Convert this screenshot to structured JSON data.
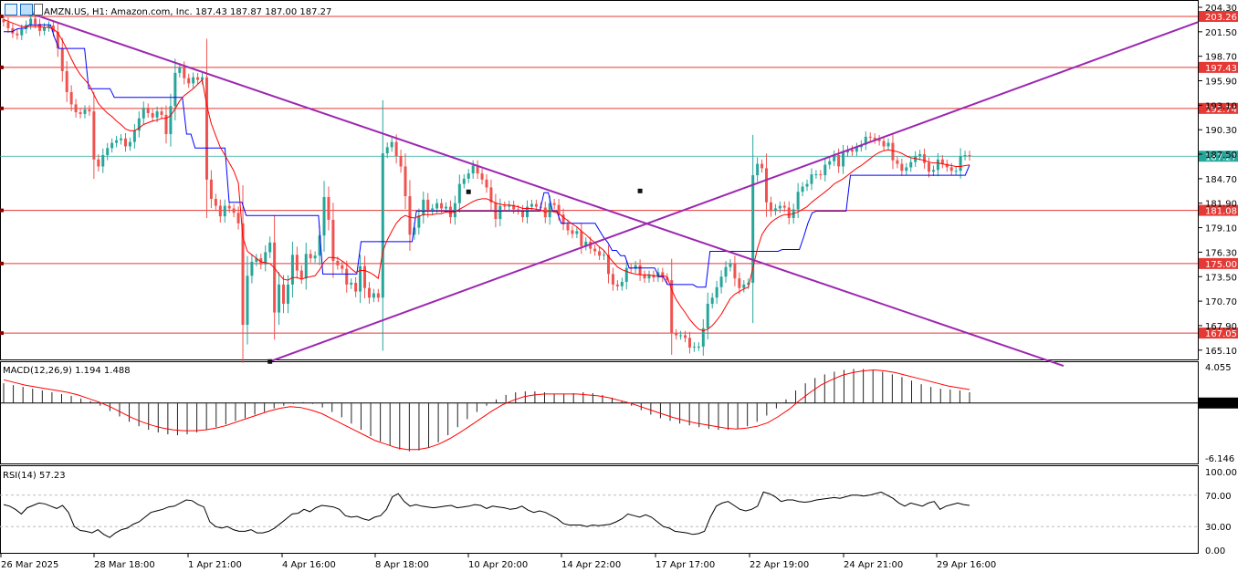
{
  "header": {
    "symbol_line": "AMZN.US, H1:  Amazon.com, Inc.  187.43 187.87 187.00 187.27",
    "icons": [
      "chart-grid-icon",
      "chart-window-icon",
      "chart-candle-icon"
    ]
  },
  "colors": {
    "bull": "#26a69a",
    "bear": "#ef5350",
    "tenkan": "#ff0000",
    "kijun": "#0000ff",
    "trendline": "#9c27b0",
    "level": "#e53935",
    "last_price": "#26a69a"
  },
  "chart_data": [
    {
      "type": "candlestick",
      "title": "AMZN.US, H1:  Amazon.com, Inc.",
      "ohlc_last": {
        "open": 187.43,
        "high": 187.87,
        "low": 187.0,
        "close": 187.27
      },
      "y_range": [
        163.2,
        204.3
      ],
      "y_ticks": [
        "204.30",
        "201.50",
        "198.70",
        "195.90",
        "193.10",
        "190.30",
        "187.50",
        "184.70",
        "181.90",
        "179.10",
        "176.30",
        "173.50",
        "170.70",
        "167.90",
        "165.10"
      ],
      "x_ticks": [
        "26 Mar 2025",
        "28 Mar 18:00",
        "1 Apr 21:00",
        "4 Apr 16:00",
        "8 Apr 18:00",
        "10 Apr 20:00",
        "14 Apr 22:00",
        "17 Apr 17:00",
        "22 Apr 19:00",
        "24 Apr 21:00",
        "29 Apr 16:00"
      ],
      "levels": [
        203.26,
        197.43,
        192.74,
        181.08,
        175.0,
        167.05
      ],
      "level_labels": [
        "203.26",
        "197.43",
        "192.74",
        "181.08",
        "175.00",
        "167.05"
      ],
      "last_price": 187.27,
      "last_price_label": "187.27",
      "closes": [
        202.6,
        201.9,
        201.3,
        201.1,
        201.8,
        202.3,
        203.0,
        202.4,
        201.6,
        202.0,
        202.2,
        201.5,
        199.6,
        197.0,
        194.6,
        193.2,
        192.3,
        192.1,
        192.6,
        192.4,
        186.9,
        186.1,
        187.4,
        188.2,
        188.8,
        189.1,
        189.3,
        188.4,
        188.9,
        190.2,
        191.6,
        192.8,
        192.2,
        191.7,
        192.4,
        192.0,
        189.8,
        193.0,
        196.8,
        197.4,
        196.2,
        195.6,
        196.3,
        196.0,
        196.3,
        184.6,
        182.4,
        181.6,
        180.4,
        181.6,
        181.3,
        180.8,
        179.6,
        168.0,
        173.6,
        175.2,
        175.6,
        174.9,
        176.3,
        177.4,
        169.4,
        172.6,
        170.4,
        172.6,
        176.0,
        174.2,
        173.3,
        176.1,
        175.6,
        175.9,
        178.2,
        182.6,
        180.0,
        175.3,
        174.8,
        174.4,
        172.6,
        172.8,
        171.8,
        174.7,
        172.2,
        171.1,
        171.6,
        171.1,
        187.6,
        188.3,
        188.9,
        187.3,
        186.1,
        182.7,
        178.3,
        179.1,
        180.5,
        182.3,
        181.0,
        181.3,
        181.9,
        181.3,
        181.5,
        180.3,
        181.9,
        184.1,
        184.7,
        185.3,
        186.2,
        185.3,
        184.6,
        183.7,
        182.0,
        180.1,
        181.6,
        181.5,
        181.7,
        181.2,
        181.1,
        180.3,
        181.5,
        181.8,
        181.5,
        181.4,
        180.3,
        181.9,
        181.7,
        180.6,
        179.5,
        178.8,
        178.4,
        178.7,
        177.0,
        177.5,
        176.7,
        176.4,
        175.9,
        176.0,
        173.8,
        172.6,
        172.4,
        172.9,
        174.5,
        174.4,
        174.8,
        173.7,
        173.3,
        173.7,
        173.4,
        174.0,
        173.4,
        173.1,
        167.0,
        166.8,
        166.8,
        166.5,
        165.4,
        165.5,
        165.5,
        167.6,
        170.4,
        171.1,
        172.3,
        173.5,
        174.6,
        175.0,
        173.3,
        172.2,
        172.6,
        172.8,
        185.1,
        186.4,
        185.9,
        182.0,
        181.0,
        181.3,
        181.6,
        181.4,
        180.2,
        181.2,
        183.2,
        183.8,
        184.1,
        185.2,
        185.2,
        185.1,
        186.3,
        186.7,
        187.4,
        186.1,
        187.7,
        188.0,
        187.8,
        188.3,
        188.6,
        189.5,
        189.4,
        189.2,
        189.0,
        188.4,
        188.8,
        186.8,
        186.4,
        185.6,
        186.0,
        186.6,
        187.3,
        187.5,
        186.5,
        185.5,
        185.7,
        186.9,
        186.4,
        186.0,
        185.6,
        185.6,
        187.3,
        187.4,
        187.27
      ],
      "tenkan": [
        202.9,
        202.7,
        202.5,
        202.3,
        202.1,
        202.1,
        202.1,
        202.1,
        202.1,
        202.0,
        202.0,
        201.8,
        201.4,
        200.5,
        199.5,
        198.4,
        197.4,
        196.6,
        196.0,
        195.4,
        194.3,
        193.3,
        192.7,
        192.2,
        191.8,
        191.3,
        190.9,
        190.4,
        190.2,
        190.2,
        190.5,
        190.9,
        191.1,
        191.3,
        191.4,
        191.6,
        191.6,
        191.9,
        192.7,
        193.6,
        194.2,
        194.6,
        195.0,
        195.5,
        196.0,
        193.1,
        191.0,
        189.6,
        188.3,
        187.4,
        186.5,
        185.6,
        184.2,
        178.0,
        176.4,
        176.0,
        175.6,
        175.2,
        175.1,
        175.0,
        174.5,
        173.8,
        173.2,
        173.1,
        173.4,
        173.4,
        173.2,
        173.4,
        173.5,
        173.6,
        174.3,
        175.2,
        175.7,
        175.7,
        175.6,
        175.3,
        174.9,
        174.4,
        174.0,
        174.2,
        174.2,
        174.0,
        173.7,
        173.3,
        176.4,
        177.7,
        178.7,
        179.6,
        180.2,
        180.5,
        180.3,
        180.2,
        180.4,
        180.6,
        180.6,
        180.6,
        180.7,
        180.7,
        180.9,
        180.8,
        180.9,
        181.2,
        181.5,
        181.8,
        182.1,
        182.3,
        182.4,
        182.4,
        182.2,
        181.9,
        181.8,
        181.7,
        181.7,
        181.6,
        181.5,
        181.3,
        181.3,
        181.3,
        181.2,
        181.1,
        180.9,
        181.0,
        180.9,
        180.7,
        180.3,
        179.9,
        179.5,
        179.2,
        178.7,
        178.3,
        177.8,
        177.4,
        176.9,
        176.5,
        175.8,
        175.2,
        174.6,
        174.3,
        174.1,
        173.9,
        173.8,
        173.7,
        173.7,
        173.7,
        173.6,
        173.6,
        173.6,
        173.5,
        172.0,
        170.9,
        170.1,
        169.4,
        168.6,
        168.0,
        167.5,
        167.3,
        167.5,
        167.9,
        168.5,
        169.2,
        170.1,
        171.0,
        171.5,
        171.8,
        172.1,
        172.3,
        174.5,
        176.7,
        178.3,
        179.1,
        179.7,
        180.1,
        180.4,
        180.6,
        180.6,
        180.7,
        180.9,
        181.2,
        181.5,
        182.0,
        182.4,
        182.8,
        183.2,
        183.6,
        184.1,
        184.4,
        184.7,
        185.1,
        185.5,
        185.9,
        186.2,
        186.6,
        187.0,
        187.4,
        187.7,
        187.9,
        188.0,
        187.9,
        187.8,
        187.6,
        187.3,
        187.1,
        187.0,
        186.9,
        186.8,
        186.6,
        186.5,
        186.5,
        186.4,
        186.3,
        186.2,
        186.1,
        186.1,
        186.2,
        186.27
      ],
      "kijun": [
        201.5,
        201.5,
        201.5,
        201.8,
        201.9,
        201.9,
        202.3,
        202.3,
        202.3,
        202.3,
        202.3,
        202.3,
        200.8,
        199.6,
        199.6,
        199.6,
        199.6,
        199.6,
        199.6,
        199.6,
        195.0,
        195.0,
        195.0,
        195.0,
        195.0,
        195.0,
        194.0,
        194.0,
        194.0,
        194.0,
        194.0,
        194.0,
        194.0,
        194.0,
        194.0,
        194.0,
        194.0,
        194.0,
        194.0,
        194.0,
        194.0,
        194.0,
        194.0,
        189.8,
        189.8,
        188.2,
        188.2,
        188.2,
        188.2,
        188.2,
        188.2,
        188.2,
        188.2,
        182.0,
        182.0,
        182.0,
        182.0,
        180.5,
        180.5,
        180.5,
        180.5,
        180.5,
        180.5,
        180.5,
        180.5,
        180.5,
        180.5,
        180.5,
        180.5,
        180.5,
        180.5,
        180.5,
        180.5,
        180.5,
        180.5,
        173.8,
        173.8,
        173.8,
        173.8,
        173.8,
        173.8,
        173.8,
        173.8,
        173.8,
        177.5,
        177.5,
        177.5,
        177.5,
        177.5,
        177.5,
        177.5,
        177.5,
        177.5,
        177.5,
        177.5,
        177.5,
        177.5,
        181.0,
        181.0,
        181.0,
        181.0,
        181.0,
        181.0,
        181.0,
        181.0,
        181.0,
        181.0,
        181.0,
        181.0,
        181.0,
        181.0,
        181.0,
        181.0,
        181.0,
        181.0,
        181.0,
        181.0,
        181.0,
        181.0,
        181.0,
        181.0,
        181.0,
        181.0,
        181.0,
        181.0,
        181.0,
        181.0,
        183.1,
        183.1,
        181.0,
        181.0,
        179.6,
        179.6,
        179.6,
        179.6,
        179.6,
        179.6,
        179.6,
        179.6,
        179.6,
        178.8,
        178.0,
        177.4,
        176.5,
        176.5,
        175.9,
        175.9,
        174.5,
        174.5,
        174.5,
        174.5,
        174.5,
        174.5,
        174.5,
        173.5,
        173.5,
        172.6,
        172.6,
        172.6,
        172.6,
        172.6,
        172.6,
        172.6,
        172.3,
        172.3,
        172.3,
        176.4,
        176.4,
        176.4,
        176.4,
        176.4,
        176.4,
        176.4,
        176.4,
        176.4,
        176.4,
        176.4,
        176.4,
        176.4,
        176.4,
        176.4,
        176.4,
        176.4,
        176.6,
        176.6,
        176.6,
        176.6,
        176.6,
        178.0,
        179.6,
        180.8,
        181.0,
        181.0,
        181.0,
        181.0,
        181.0,
        181.0,
        181.0,
        181.0,
        185.1,
        185.1,
        185.1,
        185.1,
        185.1,
        185.1,
        185.1,
        185.1,
        185.1,
        185.1,
        185.1,
        185.1,
        185.1,
        185.1,
        185.1,
        185.1,
        185.1,
        185.1,
        185.1,
        185.1,
        185.1,
        185.1,
        185.1,
        185.1,
        185.1,
        185.1,
        185.1,
        185.1,
        186.27
      ]
    },
    {
      "type": "bar",
      "title": "MACD(12,26,9) 1.194 1.488",
      "values_label": "1.194 1.488",
      "y_range": [
        -6.146,
        4.055
      ],
      "y_ticks": [
        "4.055",
        "0.000",
        "-6.146"
      ],
      "macd": [
        2.2,
        2.0,
        1.8,
        1.6,
        1.4,
        1.2,
        1.0,
        0.8,
        0.5,
        0.2,
        -0.3,
        -0.9,
        -1.5,
        -2.1,
        -2.6,
        -3.0,
        -3.3,
        -3.5,
        -3.6,
        -3.5,
        -3.3,
        -3.0,
        -2.7,
        -2.4,
        -2.0,
        -1.7,
        -1.3,
        -1.0,
        -0.6,
        -0.3,
        -0.1,
        0.1,
        -0.1,
        -0.5,
        -1.0,
        -1.6,
        -2.3,
        -3.0,
        -3.7,
        -4.3,
        -4.8,
        -5.2,
        -5.4,
        -5.3,
        -5.0,
        -4.4,
        -3.6,
        -2.7,
        -1.8,
        -1.0,
        -0.3,
        0.4,
        0.9,
        1.2,
        1.3,
        1.3,
        1.2,
        1.0,
        1.0,
        1.1,
        1.2,
        1.1,
        0.9,
        0.6,
        0.2,
        -0.3,
        -0.8,
        -1.3,
        -1.7,
        -2.0,
        -2.3,
        -2.5,
        -2.7,
        -2.9,
        -3.0,
        -3.0,
        -2.9,
        -2.6,
        -2.1,
        -1.4,
        -0.6,
        0.4,
        1.4,
        2.2,
        2.8,
        3.2,
        3.5,
        3.7,
        3.8,
        3.8,
        3.7,
        3.5,
        3.2,
        2.9,
        2.5,
        2.1,
        1.8,
        1.6,
        1.5,
        1.4,
        1.2
      ],
      "signal": [
        2.6,
        2.3,
        2.0,
        1.8,
        1.6,
        1.4,
        1.2,
        0.9,
        0.5,
        0.1,
        -0.4,
        -1.0,
        -1.6,
        -2.1,
        -2.5,
        -2.8,
        -3.0,
        -3.1,
        -3.1,
        -3.0,
        -2.8,
        -2.5,
        -2.1,
        -1.7,
        -1.3,
        -0.9,
        -0.6,
        -0.4,
        -0.5,
        -0.8,
        -1.2,
        -1.8,
        -2.4,
        -3.0,
        -3.6,
        -4.2,
        -4.6,
        -5.0,
        -5.2,
        -5.2,
        -5.0,
        -4.6,
        -4.0,
        -3.3,
        -2.5,
        -1.7,
        -0.9,
        -0.2,
        0.3,
        0.7,
        0.9,
        1.0,
        1.0,
        1.0,
        1.0,
        0.9,
        0.8,
        0.6,
        0.3,
        0.0,
        -0.4,
        -0.8,
        -1.2,
        -1.6,
        -1.9,
        -2.2,
        -2.4,
        -2.6,
        -2.8,
        -2.9,
        -2.8,
        -2.6,
        -2.2,
        -1.5,
        -0.7,
        0.3,
        1.2,
        2.0,
        2.6,
        3.1,
        3.4,
        3.6,
        3.7,
        3.6,
        3.4,
        3.1,
        2.8,
        2.5,
        2.2,
        1.9,
        1.7,
        1.5
      ]
    },
    {
      "type": "line",
      "title": "RSI(14) 57.23",
      "value_label": "57.23",
      "y_range": [
        0,
        100
      ],
      "y_ticks": [
        "100.00",
        "70.00",
        "30.00",
        "0.00"
      ],
      "levels": [
        70,
        30
      ],
      "values": [
        58,
        56,
        52,
        46,
        54,
        57,
        60,
        59,
        56,
        53,
        57,
        48,
        30,
        25,
        24,
        22,
        26,
        20,
        16,
        22,
        26,
        28,
        33,
        36,
        42,
        48,
        50,
        52,
        55,
        56,
        60,
        64,
        63,
        58,
        55,
        36,
        30,
        28,
        30,
        26,
        24,
        24,
        26,
        22,
        22,
        24,
        28,
        34,
        40,
        46,
        47,
        52,
        49,
        54,
        57,
        56,
        55,
        52,
        44,
        42,
        43,
        40,
        38,
        42,
        44,
        52,
        68,
        72,
        62,
        56,
        58,
        56,
        55,
        54,
        55,
        56,
        57,
        54,
        55,
        56,
        58,
        57,
        53,
        56,
        55,
        54,
        52,
        53,
        56,
        51,
        48,
        50,
        48,
        44,
        40,
        34,
        32,
        32,
        32,
        30,
        32,
        31,
        32,
        33,
        36,
        40,
        46,
        44,
        42,
        45,
        42,
        36,
        30,
        28,
        24,
        23,
        22,
        20,
        21,
        24,
        42,
        56,
        60,
        62,
        57,
        52,
        50,
        52,
        56,
        74,
        72,
        68,
        62,
        64,
        64,
        62,
        61,
        62,
        64,
        65,
        66,
        67,
        66,
        68,
        70,
        70,
        69,
        70,
        72,
        74,
        70,
        66,
        60,
        56,
        60,
        58,
        56,
        60,
        62,
        52,
        56,
        58,
        60,
        58,
        57
      ]
    }
  ]
}
